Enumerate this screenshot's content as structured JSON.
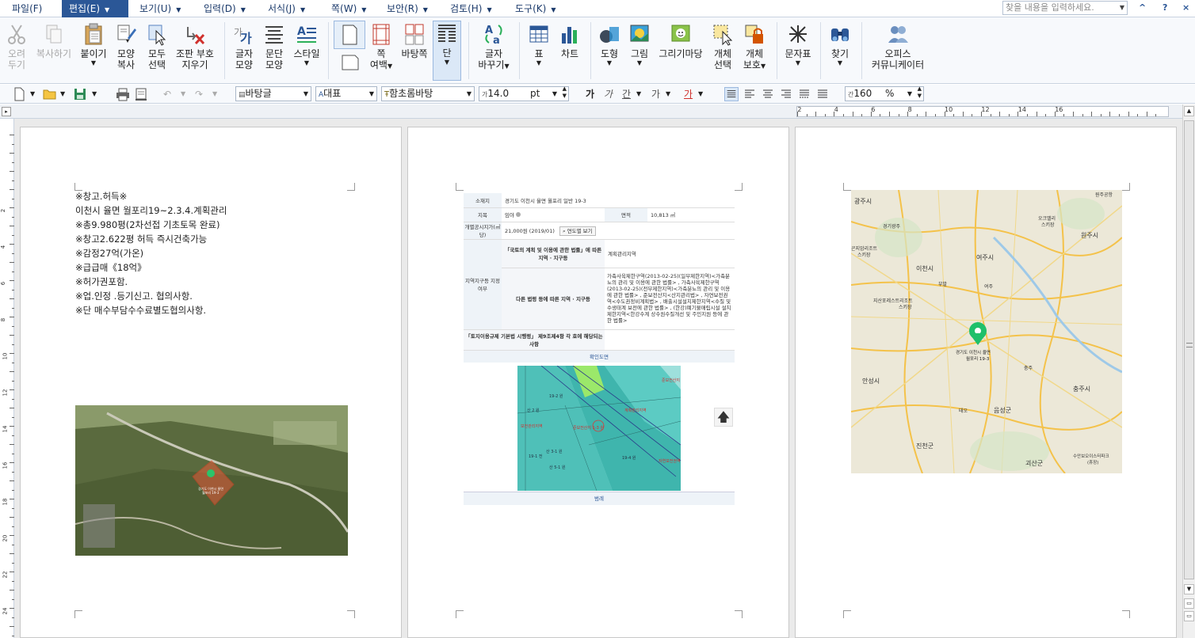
{
  "menu": {
    "items": [
      {
        "label": "파일(F)",
        "arrow": false
      },
      {
        "label": "편집(E)",
        "arrow": true
      },
      {
        "label": "보기(U)",
        "arrow": true
      },
      {
        "label": "입력(D)",
        "arrow": true
      },
      {
        "label": "서식(J)",
        "arrow": true
      },
      {
        "label": "쪽(W)",
        "arrow": true
      },
      {
        "label": "보안(R)",
        "arrow": true
      },
      {
        "label": "검토(H)",
        "arrow": true
      },
      {
        "label": "도구(K)",
        "arrow": true
      }
    ],
    "help_placeholder": "찾을 내용을 입력하세요.",
    "controls": [
      "^",
      "?",
      "×"
    ]
  },
  "ribbon": {
    "cut": [
      "오려",
      "두기"
    ],
    "copy": "복사하기",
    "paste": "붙이기",
    "format_copy": [
      "모양",
      "복사"
    ],
    "select_all": [
      "모두",
      "선택"
    ],
    "clear_combo": [
      "조판 부호",
      "지우기"
    ],
    "char_shape": [
      "글자",
      "모양"
    ],
    "para_shape": [
      "문단",
      "모양"
    ],
    "style": "스타일",
    "page_margin": [
      "쪽",
      "여백"
    ],
    "master_page": "바탕쪽",
    "column": "단",
    "replace": [
      "글자",
      "바꾸기"
    ],
    "table": "표",
    "chart": "차트",
    "shape": "도형",
    "picture": "그림",
    "gallery": "그리기마당",
    "obj_select": [
      "개체",
      "선택"
    ],
    "obj_protect": [
      "개체",
      "보호"
    ],
    "symbol": "문자표",
    "find": "찾기",
    "office_comm": [
      "오피스",
      "커뮤니케이터"
    ]
  },
  "toolbar2": {
    "style_value": "바탕글",
    "lang_value": "대표",
    "font_value": "함초롬바탕",
    "size_value": "14.0",
    "size_unit": "pt",
    "zoom_value": "160",
    "zoom_unit": "%",
    "bold": "가",
    "italic": "가",
    "underline": "간",
    "strike": "가",
    "color": "가"
  },
  "hruler": {
    "labels": [
      "2",
      "4",
      "6",
      "8",
      "10",
      "12",
      "14",
      "16"
    ]
  },
  "vruler": {
    "labels": [
      "2",
      "4",
      "6",
      "8",
      "10",
      "12",
      "14",
      "16",
      "18",
      "20",
      "22",
      "24"
    ]
  },
  "page1": {
    "lines": [
      "※창고.허득※",
      "이천시 율면 월포리19~2.3.4.계획관리",
      "※총9.980평(2차선접   기초토목 완료)",
      "※창고2.622평 허득 즉시건축가능",
      "※감정27억(가온)",
      "※급급매《18억》",
      "※허가권포함.",
      "※업.인정 .등기신고. 협의사항.",
      "※단 매수부담수수료별도협의사항."
    ],
    "photo_label": [
      "경기도 이천시 율면",
      "월포리 19-3"
    ]
  },
  "page2": {
    "rows": {
      "location_label": "소재지",
      "location_value": "경기도 이천시 율면 월포리 일반 19-3",
      "jimok_label": "지목",
      "jimok_value": "임야",
      "area_label": "면적",
      "area_value": "10,813 ㎡",
      "price_label": "개별공시지가(㎡당)",
      "price_value": "21,000원 (2019/01)",
      "price_button": "연도별 보기",
      "zone_label": "지역지구등 지정여부",
      "law1_label": "「국토의 계획 및 이용에 관한 법률」에 따른 지역 · 지구등",
      "law1_value": "계획관리지역",
      "law2_label": "다른 법령 등에 따른 지역 · 지구등",
      "law2_value": "가축사육제한구역(2013-02-25)(일부제한지역)<가축분뇨의 관리 및 이용에 관한 법률> , 가축사육제한구역(2013-02-25)(전부제한지역)<가축분뇨의 관리 및 이용에 관한 법률> , 준보전산지<산지관리법> , 자연보전권역<수도권정비계획법> , 배출시설설치제한지역<수질 및 수생태계 보전에 관한 법률> , (한강)폐기물매립시설 설치제한지역<한강수계 상수원수질개선 및 주민지원 등에 관한 법률>",
      "rule_label": "「토지이용규제 기본법 시행령」 제9조제4항 각 호에 해당되는 사항",
      "confirm_label": "확인도면",
      "legend_label": "범례"
    },
    "map_labels": [
      "19-2 원",
      "산 2 원",
      "보전관리지역",
      "준보전산지 1-3 원",
      "산 3-1 원",
      "19-1 전",
      "산 5-1 원",
      "19-4 원",
      "계획관리지역",
      "준보전산지",
      "자연보전권역"
    ]
  },
  "page3": {
    "pin_label": [
      "경기도 이천시 율면",
      "월포리 19-3"
    ],
    "places": [
      "광주시",
      "원주공항",
      "오크밸리",
      "스키장",
      "원주시",
      "경기광주",
      "곤지암리조트",
      "스키장",
      "여주시",
      "이천시",
      "부발",
      "여주",
      "지산포레스트리조트",
      "스키장",
      "충주",
      "충주시",
      "안성시",
      "음성군",
      "진천군",
      "괴산군",
      "태오",
      "수안보오이스터파크",
      "(휴장)"
    ]
  }
}
